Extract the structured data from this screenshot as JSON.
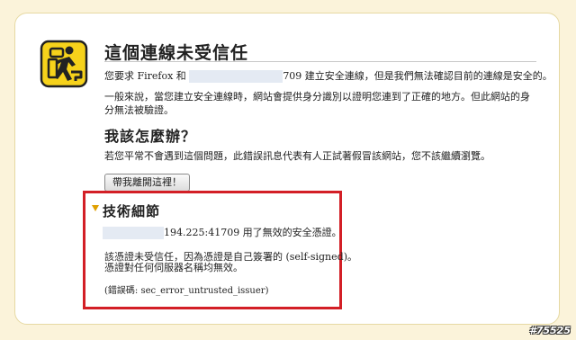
{
  "page": {
    "title": "這個連線未受信任",
    "intro_prefix": "您要求 Firefox 和",
    "intro_suffix": "709 建立安全連線，但是我們無法確認目前的連線是安全的。",
    "explanation": "一般來說，當您建立安全連線時，網站會提供身分識別以證明您連到了正確的地方。但此網站的身分無法被驗證。",
    "what_heading": "我該怎麼辦？",
    "what_text": "若您平常不會遇到這個問題，此錯誤訊息代表有人正試著假冒該網站，您不該繼續瀏覽。",
    "get_me_out_label": "帶我離開這裡！",
    "technical_heading": "技術細節",
    "tech_line1_suffix": "194.225:41709 用了無效的安全憑證。",
    "tech_line2": "該憑證未受信任，因為憑證是自己簽署的 (self-signed)。",
    "tech_line3": "憑證對任何伺服器名稱均無效。",
    "tech_error_code": "(錯誤碼: sec_error_untrusted_issuer)",
    "watermark": "#75525"
  },
  "icons": {
    "warning": "identity-warning-icon",
    "expand": "triangle-expand-icon"
  },
  "colors": {
    "background": "#fbf3da",
    "highlight_box": "#d31f26",
    "icon_yellow": "#f6d21b"
  }
}
